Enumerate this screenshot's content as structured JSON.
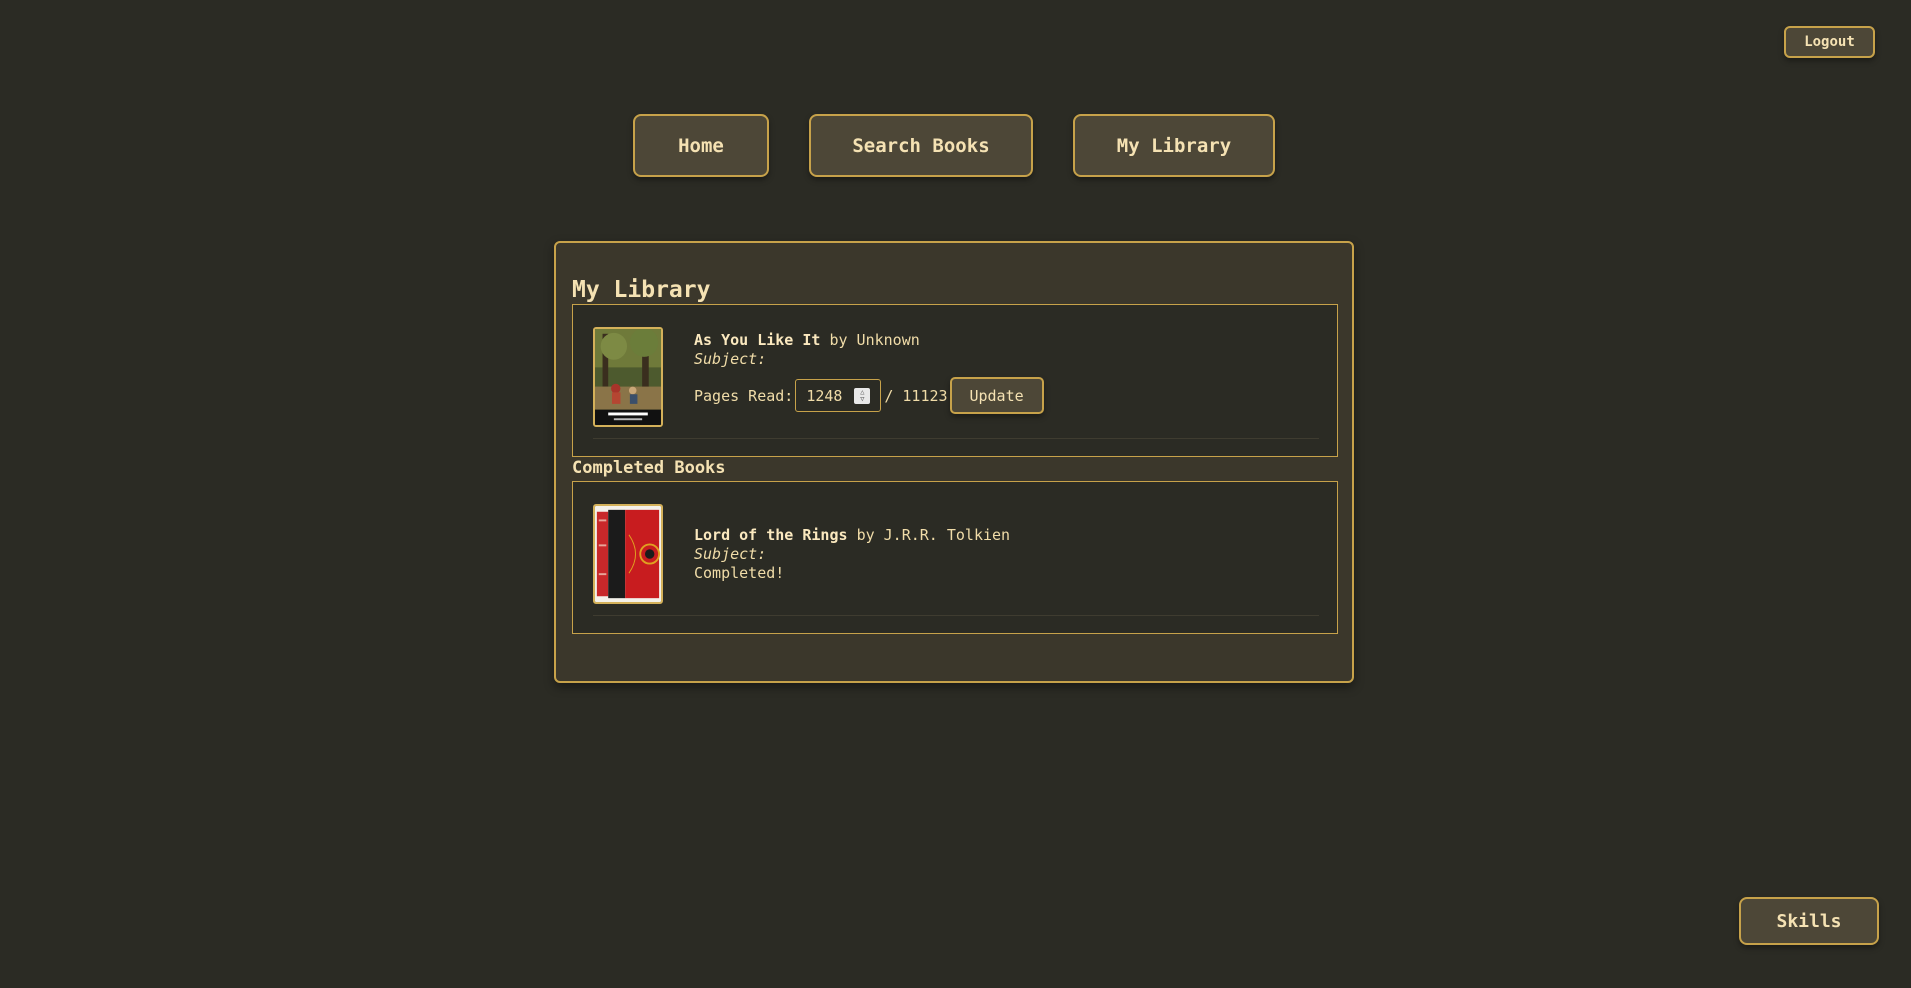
{
  "header": {
    "logout_label": "Logout"
  },
  "nav": {
    "home_label": "Home",
    "search_label": "Search Books",
    "library_label": "My Library"
  },
  "library": {
    "title": "My Library",
    "current_books": [
      {
        "title": "As You Like It",
        "by_text": "by Unknown",
        "subject_label": "Subject:",
        "pages_read_label": "Pages Read:",
        "pages_read_value": "1248",
        "pages_total_text": "/ 11123",
        "update_label": "Update",
        "cover_icon": "as-you-like-it-cover"
      }
    ],
    "completed_title": "Completed Books",
    "completed_books": [
      {
        "title": "Lord of the Rings",
        "by_text": "by J.R.R. Tolkien",
        "subject_label": "Subject:",
        "status_text": "Completed!",
        "cover_icon": "lord-of-the-rings-cover"
      }
    ]
  },
  "footer": {
    "skills_label": "Skills"
  },
  "colors": {
    "background": "#2b2b24",
    "panel": "#3b372b",
    "accent_border": "#c7a24a",
    "button_bg": "#4d4737",
    "text": "#f0dca8"
  }
}
